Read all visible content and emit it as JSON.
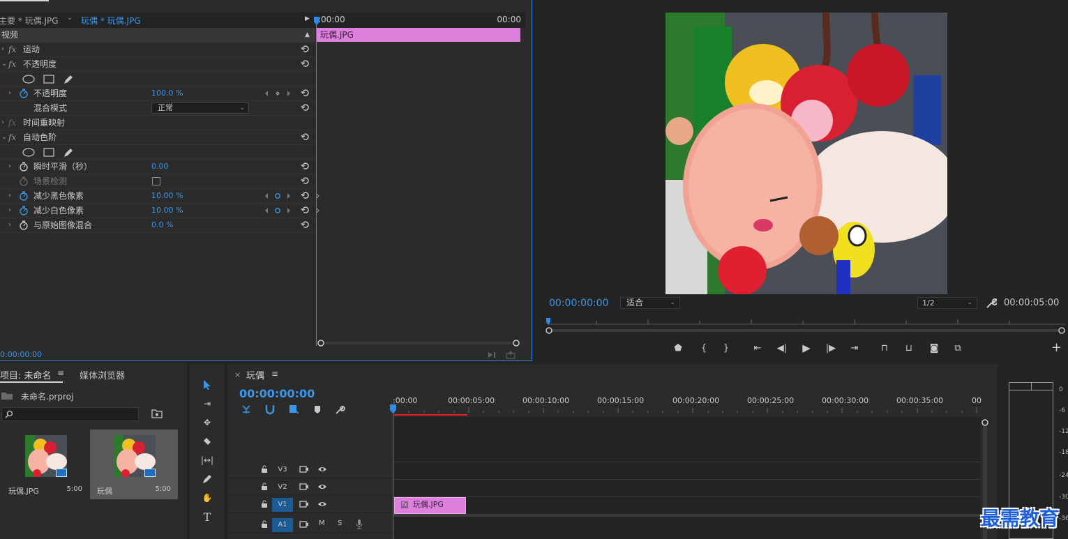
{
  "effect_controls": {
    "master_label": "主要 * 玩偶.JPG",
    "sequence_clip_label": "玩偶 * 玩偶.JPG",
    "section_label": "视频",
    "rows": {
      "motion": "运动",
      "opacity_group": "不透明度",
      "opacity_param": "不透明度",
      "opacity_value": "100.0 %",
      "blend_mode": "混合模式",
      "blend_value": "正常",
      "time_remap": "时间重映射",
      "auto_levels": "自动色阶",
      "temporal_smoothing": "瞬时平滑（秒）",
      "temporal_value": "0.00",
      "scene_detect": "场景检测",
      "black_clip": "减少黑色像素",
      "black_value": "10.00 %",
      "white_clip": "减少白色像素",
      "white_value": "10.00 %",
      "blend_original": "与原始图像混合",
      "blend_original_value": "0.0 %"
    },
    "timecode": "0:00:00:00",
    "mini_timeline": {
      "start": ":00:00",
      "end": "00:00",
      "clip_name": "玩偶.JPG"
    }
  },
  "program_monitor": {
    "timecode": "00:00:00:00",
    "fit": "适合",
    "resolution": "1/2",
    "duration": "00:00:05:00"
  },
  "project": {
    "tab_label": "项目: 未命名",
    "media_browser": "媒体浏览器",
    "menu_icon": "≡",
    "project_file": "未命名.prproj",
    "items": [
      {
        "name": "玩偶.JPG",
        "duration": "5:00"
      },
      {
        "name": "玩偶",
        "duration": "5:00"
      }
    ]
  },
  "timeline": {
    "sequence_name": "玩偶",
    "menu_icon": "≡",
    "close": "×",
    "timecode": "00:00:00:00",
    "ruler": [
      ":00:00",
      "00:00:05:00",
      "00:00:10:00",
      "00:00:15:00",
      "00:00:20:00",
      "00:00:25:00",
      "00:00:30:00",
      "00:00:35:00",
      "00"
    ],
    "tracks": [
      "V3",
      "V2",
      "V1",
      "A1"
    ],
    "audio_m": "M",
    "audio_s": "S",
    "clip_name": "玩偶.JPG",
    "fx_badge": "fx"
  },
  "meter": {
    "scale": [
      "0",
      "-6",
      "-12",
      "-18",
      "-24",
      "-30",
      "-36"
    ]
  },
  "watermark": "最需教育",
  "colors": {
    "accent_blue": "#3a97e8",
    "clip_pink": "#dd7fdd",
    "panel_bg": "#2b2b2b"
  }
}
